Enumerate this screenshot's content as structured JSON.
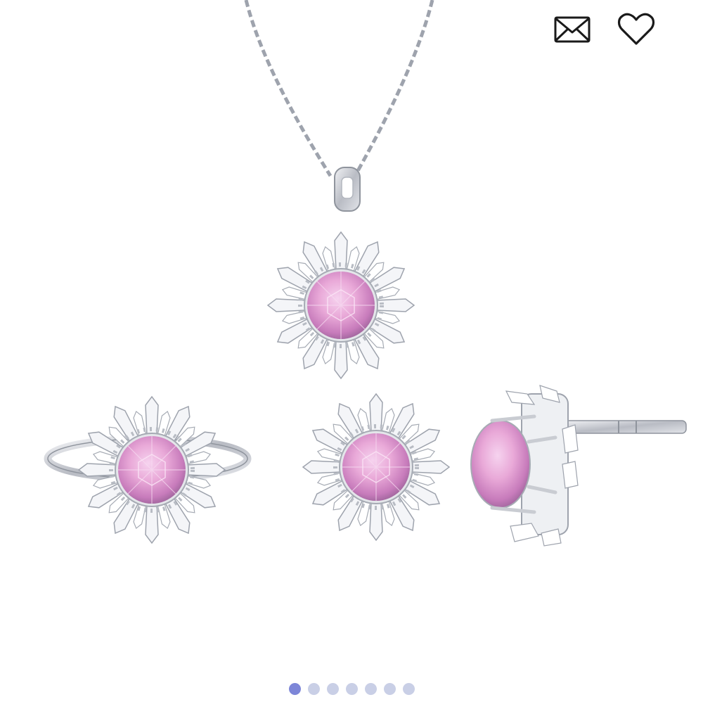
{
  "header_actions": {
    "share_icon": "mail-icon",
    "favorite_icon": "heart-icon"
  },
  "product_image": {
    "depicts": [
      "necklace-pendant",
      "ring",
      "stud-earring-front",
      "stud-earring-side"
    ],
    "gem_color": "#e9a9d8",
    "metal_color": "#c9ccd2"
  },
  "carousel": {
    "total_slides": 7,
    "active_index": 0,
    "active_color": "#7d86d8",
    "inactive_color": "#c9cfe6"
  }
}
